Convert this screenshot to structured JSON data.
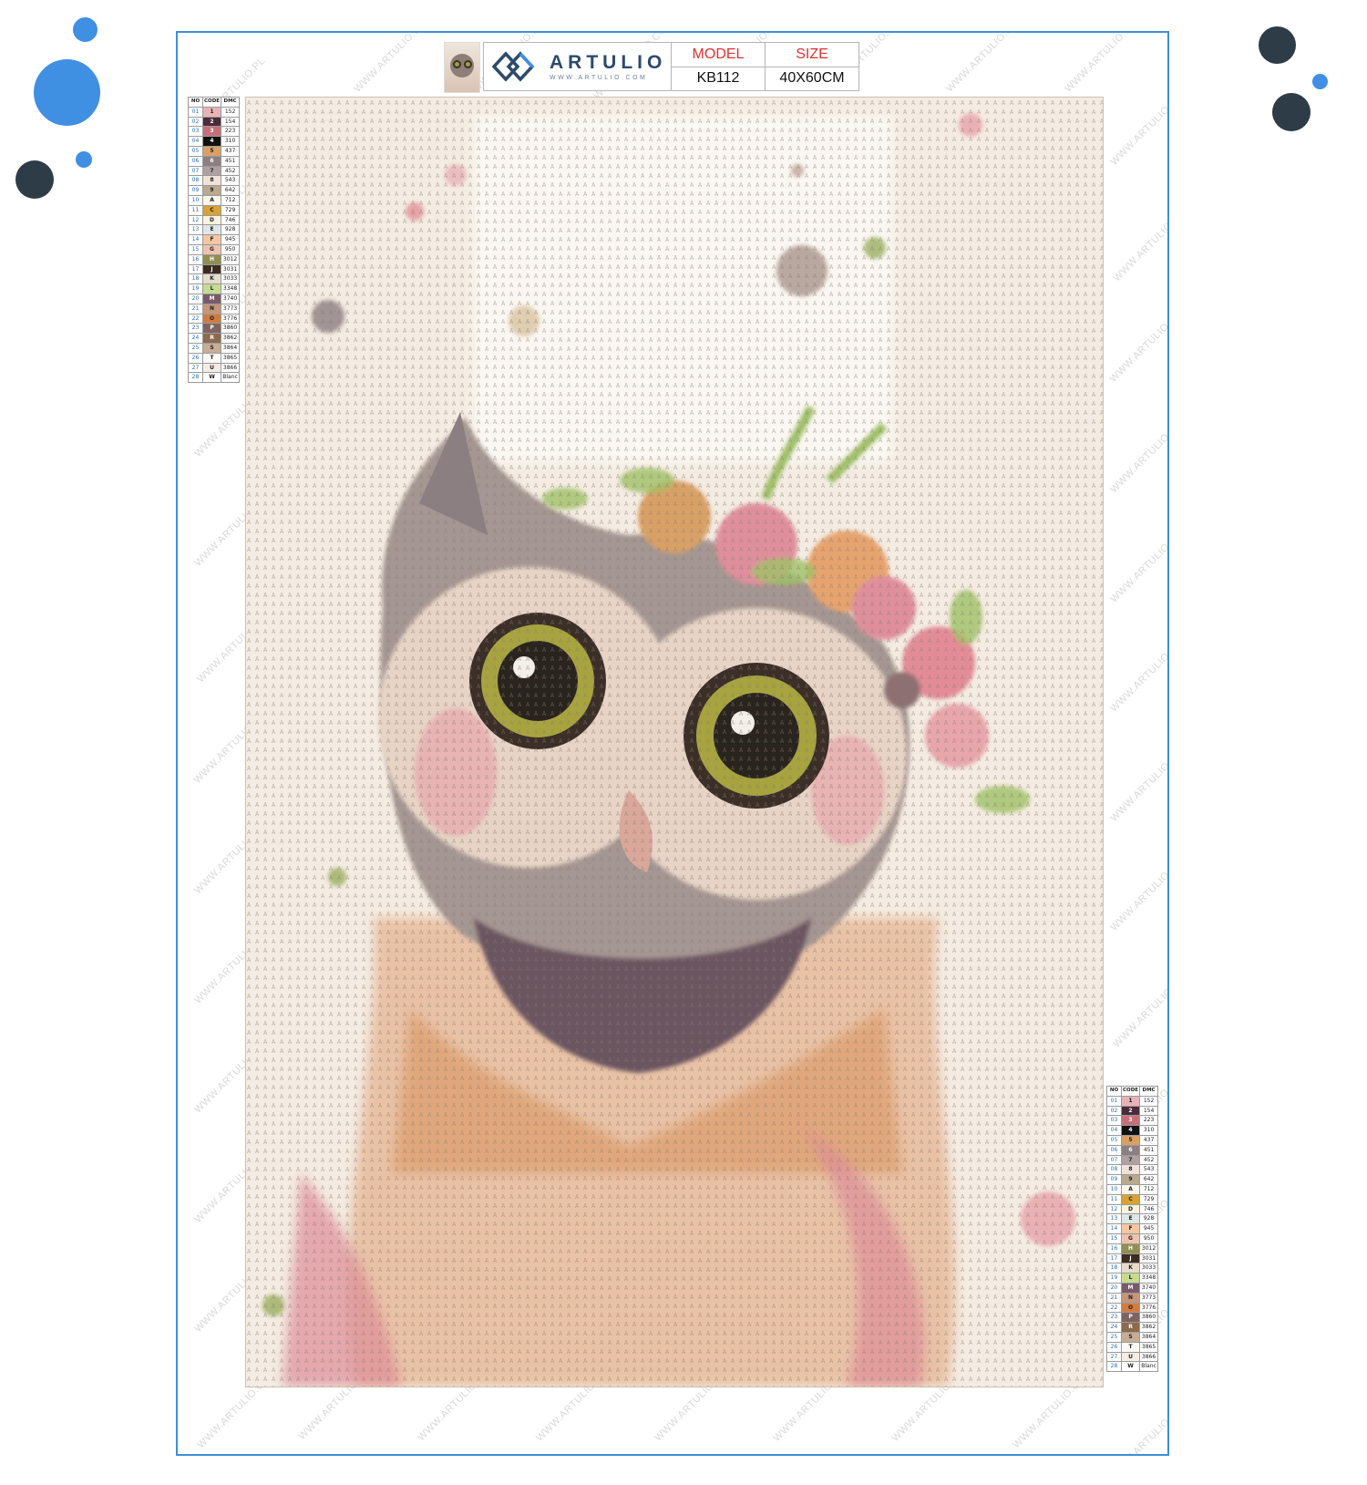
{
  "brand": {
    "name": "ARTULIO",
    "url": "WWW.ARTULIO.COM",
    "colors": {
      "primary": "#2d4a6e",
      "accent": "#e0312f",
      "frame": "#3d8fd8",
      "dot_blue": "#3f8fe3",
      "dot_dark": "#2e3c47"
    }
  },
  "spec": {
    "model_label": "MODEL",
    "model_value": "KB112",
    "size_label": "SIZE",
    "size_value": "40X60CM"
  },
  "watermarks": [
    "WWW.ARTULIO.PL",
    "WWW.ARTULIO.DE",
    "WWW.ARTULIO.FR",
    "WWW.ARTULIO.CO.UK",
    "WWW.ARTULIO.ES",
    "WWW.ARTULIO.IT",
    "WWW.ARTULIO.EU"
  ],
  "legend": {
    "headers": [
      "NO",
      "CODE",
      "DMC"
    ],
    "rows": [
      {
        "no": "01",
        "code": "1",
        "dmc": "152",
        "color": "#e8b3b8"
      },
      {
        "no": "02",
        "code": "2",
        "dmc": "154",
        "color": "#4b2a3a"
      },
      {
        "no": "03",
        "code": "3",
        "dmc": "223",
        "color": "#c66f7b"
      },
      {
        "no": "04",
        "code": "4",
        "dmc": "310",
        "color": "#111111"
      },
      {
        "no": "05",
        "code": "5",
        "dmc": "437",
        "color": "#d9a066"
      },
      {
        "no": "06",
        "code": "6",
        "dmc": "451",
        "color": "#8c7f82"
      },
      {
        "no": "07",
        "code": "7",
        "dmc": "452",
        "color": "#b0a0a2"
      },
      {
        "no": "08",
        "code": "8",
        "dmc": "543",
        "color": "#f0e2d8"
      },
      {
        "no": "09",
        "code": "9",
        "dmc": "642",
        "color": "#b8a98f"
      },
      {
        "no": "10",
        "code": "A",
        "dmc": "712",
        "color": "#fbf6e9"
      },
      {
        "no": "11",
        "code": "C",
        "dmc": "729",
        "color": "#d8a336"
      },
      {
        "no": "12",
        "code": "D",
        "dmc": "746",
        "color": "#f8f3dc"
      },
      {
        "no": "13",
        "code": "E",
        "dmc": "928",
        "color": "#dfe6e6"
      },
      {
        "no": "14",
        "code": "F",
        "dmc": "945",
        "color": "#f5c6a4"
      },
      {
        "no": "15",
        "code": "G",
        "dmc": "950",
        "color": "#eec3ad"
      },
      {
        "no": "16",
        "code": "H",
        "dmc": "3012",
        "color": "#8f8f52"
      },
      {
        "no": "17",
        "code": "J",
        "dmc": "3031",
        "color": "#3d2b1f"
      },
      {
        "no": "18",
        "code": "K",
        "dmc": "3033",
        "color": "#e6dccb"
      },
      {
        "no": "19",
        "code": "L",
        "dmc": "3348",
        "color": "#c5dc8f"
      },
      {
        "no": "20",
        "code": "M",
        "dmc": "3740",
        "color": "#7a5a6a"
      },
      {
        "no": "21",
        "code": "N",
        "dmc": "3773",
        "color": "#c69478"
      },
      {
        "no": "22",
        "code": "O",
        "dmc": "3776",
        "color": "#d37b3f"
      },
      {
        "no": "23",
        "code": "P",
        "dmc": "3860",
        "color": "#7e6461"
      },
      {
        "no": "24",
        "code": "R",
        "dmc": "3862",
        "color": "#8b6a4e"
      },
      {
        "no": "25",
        "code": "S",
        "dmc": "3864",
        "color": "#c7ad94"
      },
      {
        "no": "26",
        "code": "T",
        "dmc": "3865",
        "color": "#fbfaf7"
      },
      {
        "no": "27",
        "code": "U",
        "dmc": "3866",
        "color": "#f5ede5"
      },
      {
        "no": "28",
        "code": "W",
        "dmc": "Blanc",
        "color": "#ffffff"
      }
    ]
  },
  "pattern_glyphs": "AADDTTUUWW"
}
